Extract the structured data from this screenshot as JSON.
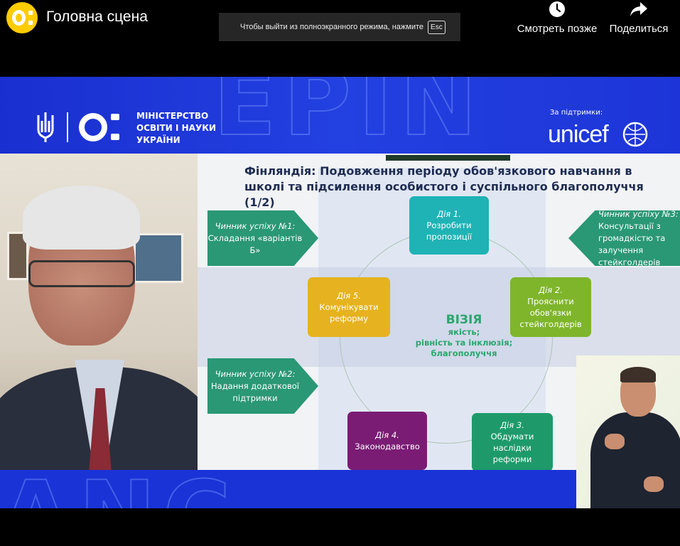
{
  "topbar": {
    "title": "Головна сцена",
    "fullscreen_hint": "Чтобы выйти из полноэкранного режима, нажмите",
    "fullscreen_key": "Esc",
    "watch_later_label": "Смотреть позже",
    "share_label": "Поделиться"
  },
  "header": {
    "ministry_line1": "МІНІСТЕРСТВО",
    "ministry_line2": "ОСВІТИ І НАУКИ",
    "ministry_line3": "УКРАЇНИ",
    "support_label": "За підтримки:",
    "partner_name": "unicef"
  },
  "slide": {
    "title": "Фінляндія: Подовження періоду обов'язкового навчання в школі та підсилення особистого і суспільного благополуччя (1/2)",
    "actions": [
      {
        "label": "Дія 1.",
        "text": "Розробити пропозиції"
      },
      {
        "label": "Дія 2.",
        "text": "Прояснити обов'язки стейкголдерів"
      },
      {
        "label": "Дія 3.",
        "text": "Обдумати наслідки реформи"
      },
      {
        "label": "Дія 4.",
        "text": "Законодавство"
      },
      {
        "label": "Дія 5.",
        "text": "Комунікувати реформу"
      }
    ],
    "factors": [
      {
        "label": "Чинник успіху №1:",
        "text": "Складання «варіантів Б»"
      },
      {
        "label": "Чинник успіху №2:",
        "text": "Надання додаткової підтримки"
      },
      {
        "label": "Чинник успіху №3:",
        "text": "Консультації з громадкістю та залучення стейкголдерів"
      }
    ],
    "vision": {
      "title": "ВІЗІЯ",
      "line1": "якість;",
      "line2": "рівність та інклюзія;",
      "line3": "благополуччя"
    }
  },
  "colors": {
    "brand_blue": "#1a33d6",
    "action1": "#1fb3b5",
    "action2": "#7fb52b",
    "action3": "#1e9a6a",
    "action4": "#7a1c74",
    "action5": "#e6b21f",
    "factor": "#2a9775",
    "vision": "#2aa66d"
  }
}
